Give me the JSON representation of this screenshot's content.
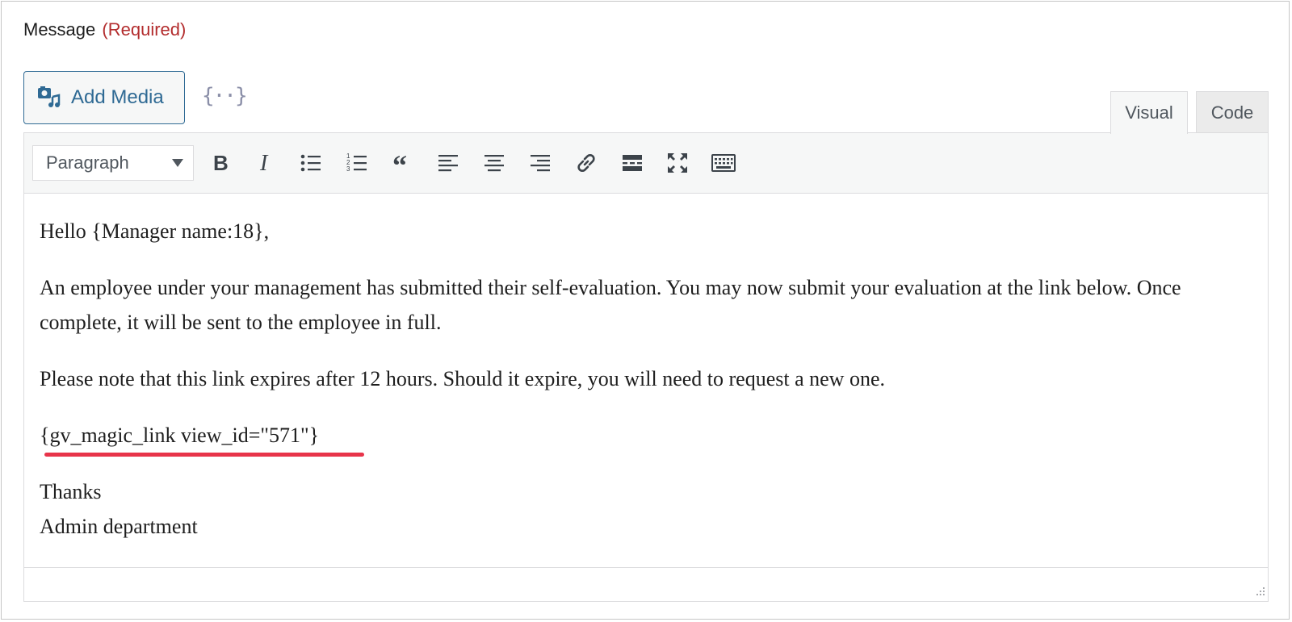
{
  "field": {
    "label": "Message",
    "required_text": "(Required)"
  },
  "media": {
    "add_media_label": "Add Media",
    "merge_tag_icon_text": "{··}"
  },
  "tabs": {
    "visual": "Visual",
    "code": "Code",
    "active": "visual"
  },
  "toolbar": {
    "format_value": "Paragraph",
    "buttons": [
      "bold-icon",
      "italic-icon",
      "bulleted-list-icon",
      "numbered-list-icon",
      "blockquote-icon",
      "align-left-icon",
      "align-center-icon",
      "align-right-icon",
      "link-icon",
      "read-more-icon",
      "fullscreen-icon",
      "toolbar-toggle-icon"
    ]
  },
  "content": {
    "greeting": "Hello {Manager name:18},",
    "paragraph1": "An employee under your management has submitted their self-evaluation. You may now submit your evaluation at the link below. Once complete, it will be sent to the employee in full.",
    "paragraph2": "Please note that this link expires after 12 hours. Should it expire, you will need to request a new one.",
    "magic_link": "{gv_magic_link view_id=\"571\"}",
    "signoff": "Thanks",
    "signature": "Admin department"
  },
  "colors": {
    "required": "#b32d2e",
    "primary": "#2f6a94",
    "highlight": "#e8344a"
  }
}
